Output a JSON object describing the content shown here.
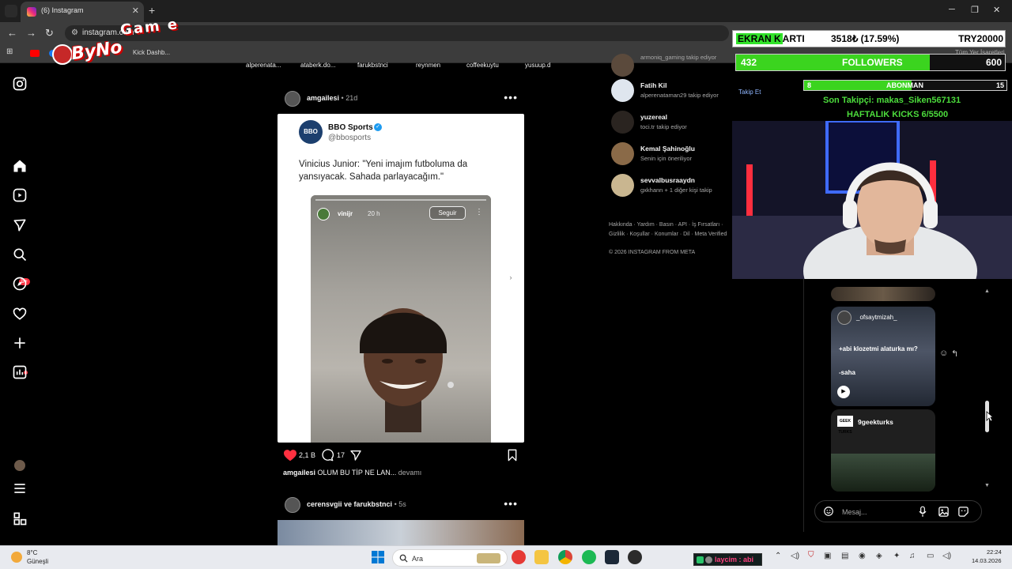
{
  "browser": {
    "tab_title": "(6) Instagram",
    "url": "instagram.com",
    "bookmarks": [
      "Kick Dashb...",
      "Tüm Yer İşaretleri"
    ]
  },
  "logo": {
    "line1": "ByNo",
    "line2": "Gam e"
  },
  "instagram": {
    "nav_badge": "9+",
    "stories": [
      "alperenata...",
      "ataberk.do...",
      "farukbstnci",
      "reynmen",
      "coffeekuytu",
      "yusuup.d"
    ],
    "post1": {
      "user": "amgailesi",
      "time": "• 21d",
      "tweet_name": "BBO Sports",
      "tweet_handle": "@bbosports",
      "tweet_avatar_text": "BBO",
      "tweet_text": "Vinicius Junior: \"Yeni imajım futboluma da yansıyacak. Sahada parlayacağım.\"",
      "story_user": "vinijr",
      "story_time": "20 h",
      "story_follow": "Seguir",
      "likes": "2,1 B",
      "comments": "17",
      "caption_user": "amgailesi",
      "caption_text": "OLUM BU TİP NE LAN...",
      "caption_more": "devamı"
    },
    "post2": {
      "user": "cerensvgii ve farukbstnci",
      "time": "• 5s"
    },
    "suggestions": [
      {
        "name": "",
        "sub": "armoniq_gaming takip ediyor"
      },
      {
        "name": "Fatih Kil",
        "sub": "alperenataman29 takip ediyor"
      },
      {
        "name": "yuzereal",
        "sub": "toci.tr takip ediyor"
      },
      {
        "name": "Kemal Şahinoğlu",
        "sub": "Senin için öneriliyor"
      },
      {
        "name": "sevvalbusraaydn",
        "sub": "gxkhann + 1 diğer kişi takip"
      }
    ],
    "footer": "Hakkında · Yardım · Basın · API · İş Fırsatları · Gizlilik · Koşullar · Konumlar · Dil · Meta Verified",
    "copyright": "© 2026 INSTAGRAM FROM META",
    "takip_et": "Takip Et"
  },
  "overlay": {
    "gpu_title_hi": "EKRAN K",
    "gpu_title_rest": "ARTI",
    "gpu_value": "3518₺ (17.59%)",
    "gpu_goal": "TRY20000",
    "followers_current": "432",
    "followers_label": "FOLLOWERS",
    "followers_goal": "600",
    "followers_progress": 0.72,
    "sub_current": "8",
    "sub_label": "ABONMAN",
    "sub_goal": "15",
    "sub_progress": 0.533,
    "last_follower": "Son Takipçi: makas_Siken567131",
    "kicks": "HAFTALIK KICKS 6/5500"
  },
  "dm": {
    "msg2_user": "_ofsaytmizah_",
    "msg2_text1": "+abi klozetmi alaturka mı?",
    "msg2_text2": "-saha",
    "msg3_user": "9geekturks",
    "msg3_avatar": "GEEK TURKS",
    "placeholder": "Mesaj..."
  },
  "taskbar": {
    "temp": "8°C",
    "weather": "Güneşli",
    "search": "Ara",
    "ticker_user": "laycim : abi",
    "time": "22:24",
    "date": "14.03.2026"
  }
}
